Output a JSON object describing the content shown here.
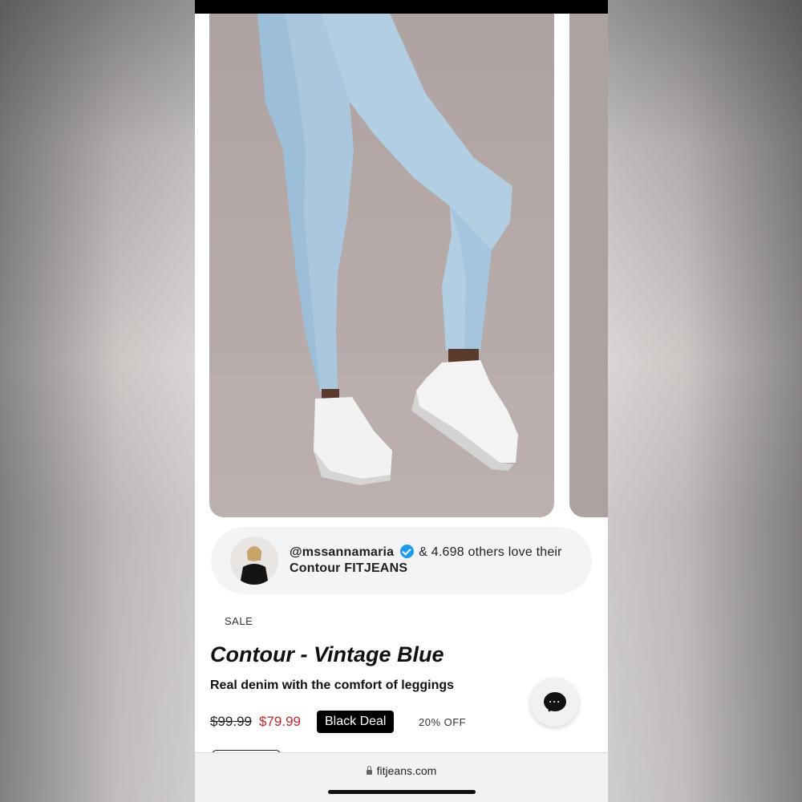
{
  "browser": {
    "url": "fitjeans.com",
    "lock_icon": "lock-icon"
  },
  "gallery": {
    "image_alt": "Model wearing light blue skinny jeans and white sneakers"
  },
  "social_proof": {
    "handle": "@mssannamaria",
    "verified_icon": "verified-badge-icon",
    "love_text": "& 4.698 others love their",
    "product_ref": "Contour FITJEANS"
  },
  "product": {
    "tag": "SALE",
    "title": "Contour - Vintage Blue",
    "subtitle": "Real denim with the comfort of leggings",
    "price_original": "$99.99",
    "price_sale": "$79.99",
    "deal_label": "Black Deal",
    "discount": "20% OFF"
  },
  "chat": {
    "icon": "chat-bubble-icon",
    "dots": "···"
  },
  "colors": {
    "sale_price": "#c62828",
    "badge_bg": "#000000",
    "verified": "#1d9bf0"
  }
}
